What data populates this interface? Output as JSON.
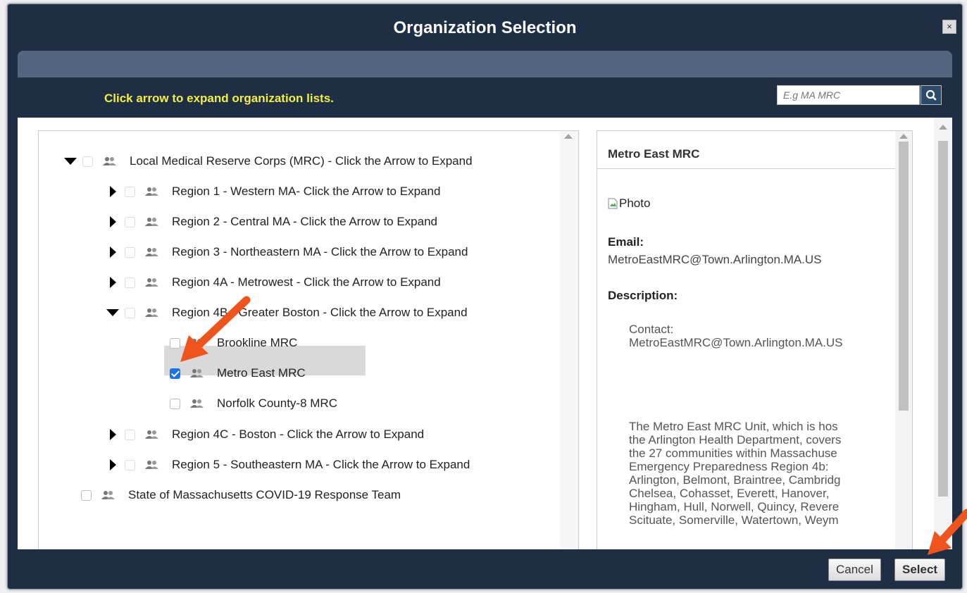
{
  "dialog": {
    "title": "Organization Selection",
    "close_label": "×",
    "instruction": "Click arrow to expand organization lists.",
    "search": {
      "placeholder": "E.g MA MRC"
    }
  },
  "tree": [
    {
      "label": "Local Medical Reserve Corps (MRC) - Click the Arrow to Expand",
      "expander": "expanded",
      "checked": false
    },
    {
      "label": "Region 1 - Western MA- Click the Arrow to Expand",
      "expander": "collapsed",
      "checked": false
    },
    {
      "label": "Region 2 - Central MA - Click the Arrow to Expand",
      "expander": "collapsed",
      "checked": false
    },
    {
      "label": "Region 3 - Northeastern MA - Click the Arrow to Expand",
      "expander": "collapsed",
      "checked": false
    },
    {
      "label": "Region 4A - Metrowest - Click the Arrow to Expand",
      "expander": "collapsed",
      "checked": false
    },
    {
      "label": "Region 4B - Greater Boston - Click the Arrow to Expand",
      "expander": "expanded",
      "checked": false
    },
    {
      "label": "Brookline MRC",
      "expander": "none",
      "checked": false
    },
    {
      "label": "Metro East MRC",
      "expander": "none",
      "checked": true,
      "selected": true
    },
    {
      "label": "Norfolk County-8 MRC",
      "expander": "none",
      "checked": false
    },
    {
      "label": "Region 4C - Boston - Click the Arrow to Expand",
      "expander": "collapsed",
      "checked": false
    },
    {
      "label": "Region 5 - Southeastern MA - Click the Arrow to Expand",
      "expander": "collapsed",
      "checked": false
    },
    {
      "label": "State of Massachusetts COVID-19 Response Team",
      "expander": "none",
      "checked": false
    }
  ],
  "details": {
    "title": "Metro East MRC",
    "photo_alt": "Photo",
    "email_label": "Email:",
    "email": "MetroEastMRC@Town.Arlington.MA.US",
    "description_label": "Description:",
    "description_contact": "Contact:\nMetroEastMRC@Town.Arlington.MA.US",
    "description_body": "The Metro East MRC Unit, which is hos\nthe Arlington Health Department, covers\nthe 27 communities within Massachuse\nEmergency Preparedness Region 4b:\nArlington, Belmont, Braintree, Cambridg\nChelsea, Cohasset, Everett, Hanover,\nHingham, Hull, Norwell, Quincy, Revere\nScituate, Somerville, Watertown, Weym"
  },
  "buttons": {
    "cancel": "Cancel",
    "select": "Select"
  },
  "icons": [
    "close-icon",
    "search-icon",
    "group-icon",
    "expand-arrow-icon",
    "collapse-arrow-icon",
    "broken-image-icon",
    "annotation-arrow"
  ],
  "colors": {
    "dialog_bg": "#1e2f45",
    "band": "#53667f",
    "instruction": "#f4ef3b",
    "checkbox_checked": "#1a73e8",
    "annotation": "#f0541d"
  }
}
